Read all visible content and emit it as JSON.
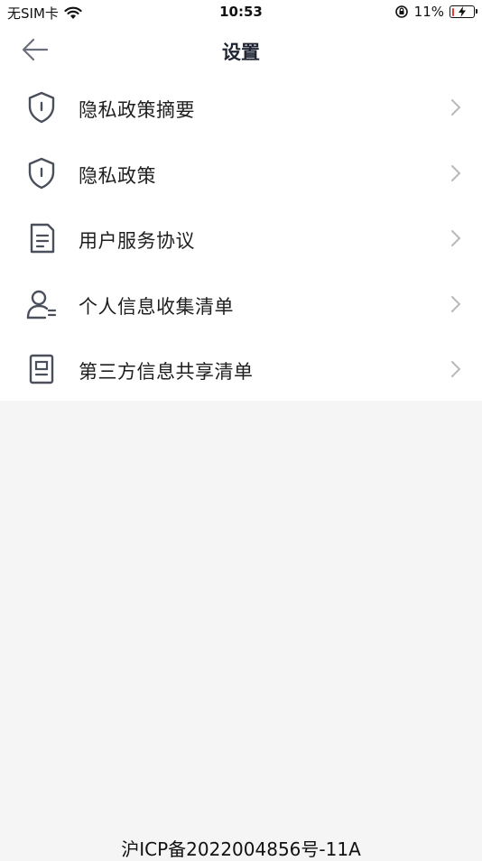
{
  "status_bar": {
    "carrier": "无SIM卡",
    "time": "10:53",
    "battery_text": "11%",
    "battery_level": 0.11,
    "battery_color": "#e53935"
  },
  "nav": {
    "title": "设置",
    "back_icon": "arrow-left-icon"
  },
  "menu": {
    "items": [
      {
        "label": "隐私政策摘要",
        "icon": "shield-icon"
      },
      {
        "label": "隐私政策",
        "icon": "shield-icon"
      },
      {
        "label": "用户服务协议",
        "icon": "document-icon"
      },
      {
        "label": "个人信息收集清单",
        "icon": "user-list-icon"
      },
      {
        "label": "第三方信息共享清单",
        "icon": "id-card-icon"
      }
    ]
  },
  "footer": {
    "icp": "沪ICP备2022004856号-11A"
  },
  "colors": {
    "icon": "#4a4f5c",
    "chevron": "#b8b8bd",
    "page_bg": "#f5f5f5",
    "card_bg": "#ffffff"
  }
}
